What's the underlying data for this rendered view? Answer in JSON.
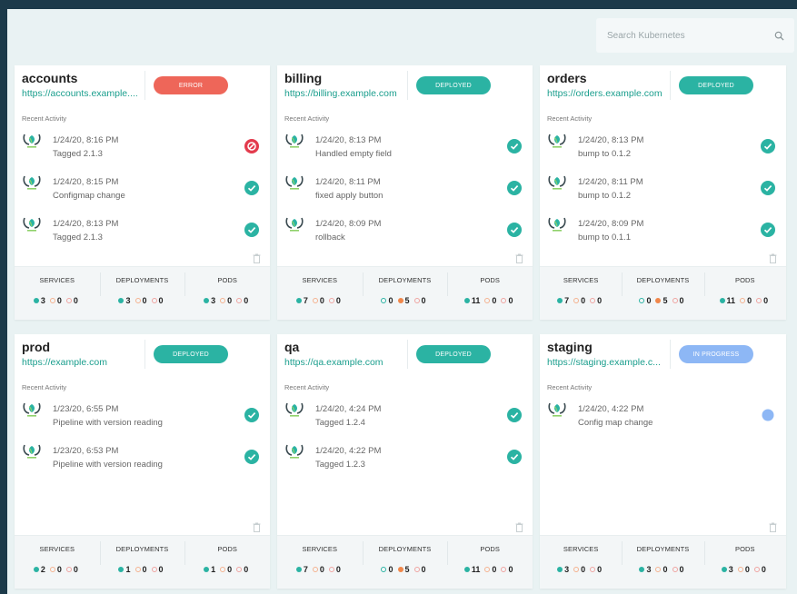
{
  "search": {
    "placeholder": "Search Kubernetes"
  },
  "colors": {
    "error": "#ee6659",
    "deployed": "#2bb3a3",
    "in_progress": "#8db7f5",
    "accent": "#1a9e8d",
    "bg": "#e9f2f3"
  },
  "recent_label": "Recent Activity",
  "stat_labels": {
    "services": "SERVICES",
    "deployments": "DEPLOYMENTS",
    "pods": "PODS"
  },
  "clusters": [
    {
      "name": "accounts",
      "url": "https://accounts.example....",
      "status": "ERROR",
      "status_kind": "error",
      "activities": [
        {
          "time": "1/24/20, 8:16 PM",
          "message": "Tagged 2.1.3",
          "state": "error"
        },
        {
          "time": "1/24/20, 8:15 PM",
          "message": "Configmap change",
          "state": "success"
        },
        {
          "time": "1/24/20, 8:13 PM",
          "message": "Tagged 2.1.3",
          "state": "success"
        }
      ],
      "services": {
        "ok": 3,
        "pending": 0,
        "failed": 0
      },
      "deployments": {
        "ok": 3,
        "pending": 0,
        "failed": 0
      },
      "pods": {
        "ok": 3,
        "pending": 0,
        "failed": 0
      }
    },
    {
      "name": "billing",
      "url": "https://billing.example.com",
      "status": "DEPLOYED",
      "status_kind": "deployed",
      "activities": [
        {
          "time": "1/24/20, 8:13 PM",
          "message": "Handled empty field",
          "state": "success"
        },
        {
          "time": "1/24/20, 8:11 PM",
          "message": "fixed apply button",
          "state": "success"
        },
        {
          "time": "1/24/20, 8:09 PM",
          "message": "rollback",
          "state": "success"
        }
      ],
      "services": {
        "ok": 7,
        "pending": 0,
        "failed": 0
      },
      "deployments": {
        "ok": 0,
        "pending": 5,
        "failed": 0
      },
      "pods": {
        "ok": 11,
        "pending": 0,
        "failed": 0
      }
    },
    {
      "name": "orders",
      "url": "https://orders.example.com",
      "status": "DEPLOYED",
      "status_kind": "deployed",
      "activities": [
        {
          "time": "1/24/20, 8:13 PM",
          "message": "bump to 0.1.2",
          "state": "success"
        },
        {
          "time": "1/24/20, 8:11 PM",
          "message": "bump to 0.1.2",
          "state": "success"
        },
        {
          "time": "1/24/20, 8:09 PM",
          "message": "bump to 0.1.1",
          "state": "success"
        }
      ],
      "services": {
        "ok": 7,
        "pending": 0,
        "failed": 0
      },
      "deployments": {
        "ok": 0,
        "pending": 5,
        "failed": 0
      },
      "pods": {
        "ok": 11,
        "pending": 0,
        "failed": 0
      }
    },
    {
      "name": "prod",
      "url": "https://example.com",
      "status": "DEPLOYED",
      "status_kind": "deployed",
      "activities": [
        {
          "time": "1/23/20, 6:55 PM",
          "message": "Pipeline with version reading",
          "state": "success"
        },
        {
          "time": "1/23/20, 6:53 PM",
          "message": "Pipeline with version reading",
          "state": "success"
        }
      ],
      "services": {
        "ok": 2,
        "pending": 0,
        "failed": 0
      },
      "deployments": {
        "ok": 1,
        "pending": 0,
        "failed": 0
      },
      "pods": {
        "ok": 1,
        "pending": 0,
        "failed": 0
      }
    },
    {
      "name": "qa",
      "url": "https://qa.example.com",
      "status": "DEPLOYED",
      "status_kind": "deployed",
      "activities": [
        {
          "time": "1/24/20, 4:24 PM",
          "message": "Tagged 1.2.4",
          "state": "success"
        },
        {
          "time": "1/24/20, 4:22 PM",
          "message": "Tagged 1.2.3",
          "state": "success"
        }
      ],
      "services": {
        "ok": 7,
        "pending": 0,
        "failed": 0
      },
      "deployments": {
        "ok": 0,
        "pending": 5,
        "failed": 0
      },
      "pods": {
        "ok": 11,
        "pending": 0,
        "failed": 0
      }
    },
    {
      "name": "staging",
      "url": "https://staging.example.c...",
      "status": "IN PROGRESS",
      "status_kind": "in_progress",
      "activities": [
        {
          "time": "1/24/20, 4:22 PM",
          "message": "Config map change",
          "state": "pending"
        }
      ],
      "services": {
        "ok": 3,
        "pending": 0,
        "failed": 0
      },
      "deployments": {
        "ok": 3,
        "pending": 0,
        "failed": 0
      },
      "pods": {
        "ok": 3,
        "pending": 0,
        "failed": 0
      }
    }
  ]
}
